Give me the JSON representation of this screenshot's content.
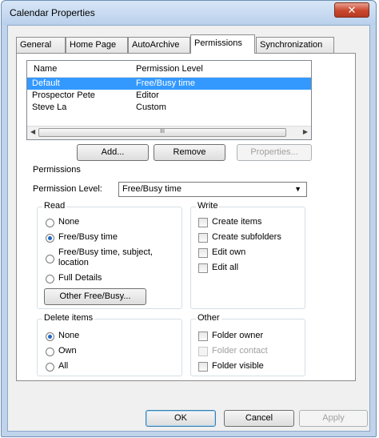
{
  "window": {
    "title": "Calendar Properties",
    "close_label": "✕"
  },
  "tabs": [
    {
      "label": "General"
    },
    {
      "label": "Home Page"
    },
    {
      "label": "AutoArchive"
    },
    {
      "label": "Permissions"
    },
    {
      "label": "Synchronization"
    }
  ],
  "permissions_list": {
    "columns": [
      "Name",
      "Permission Level"
    ],
    "rows": [
      {
        "name": "Default",
        "level": "Free/Busy time",
        "selected": true
      },
      {
        "name": "Prospector Pete",
        "level": "Editor",
        "selected": false
      },
      {
        "name": "Steve La",
        "level": "Custom",
        "selected": false
      }
    ],
    "scroll_grip": "III"
  },
  "buttons": {
    "add": "Add...",
    "remove": "Remove",
    "properties": "Properties...",
    "other_free_busy": "Other Free/Busy...",
    "ok": "OK",
    "cancel": "Cancel",
    "apply": "Apply"
  },
  "permissions_section": {
    "title": "Permissions",
    "level_label": "Permission Level:",
    "level_value": "Free/Busy time"
  },
  "read": {
    "title": "Read",
    "options": [
      "None",
      "Free/Busy time",
      "Free/Busy time, subject,",
      "location",
      "Full Details"
    ],
    "selected": "Free/Busy time"
  },
  "write": {
    "title": "Write",
    "options": [
      "Create items",
      "Create subfolders",
      "Edit own",
      "Edit all"
    ]
  },
  "delete_items": {
    "title": "Delete items",
    "options": [
      "None",
      "Own",
      "All"
    ],
    "selected": "None"
  },
  "other": {
    "title": "Other",
    "options": [
      "Folder owner",
      "Folder contact",
      "Folder visible"
    ]
  }
}
